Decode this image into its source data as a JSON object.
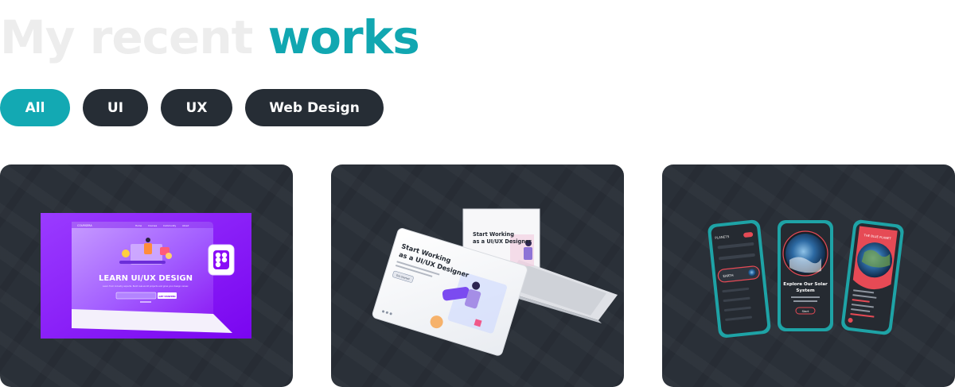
{
  "heading": {
    "muted": "My recent ",
    "accent": "works"
  },
  "filters": [
    {
      "label": "All",
      "active": true
    },
    {
      "label": "UI",
      "active": false
    },
    {
      "label": "UX",
      "active": false
    },
    {
      "label": "Web Design",
      "active": false
    }
  ],
  "projects": [
    {
      "brand": "COURSERA",
      "nav": [
        "Home",
        "Courses",
        "Community",
        "About"
      ],
      "headline": "LEARN UI/UX DESIGN",
      "subtext": "Learn from industry experts. Build real-world projects and grow your design career.",
      "cta": "GET STARTED",
      "icon": "figma-icon"
    },
    {
      "headline_line1": "Start Working",
      "headline_line2": "as a UI/UX Designer",
      "screen_headline_line1": "Start Working",
      "screen_headline_line2": "as a UI/UX Designer",
      "button": "Get Started",
      "device": "laptop-icon"
    },
    {
      "phone1": {
        "title": "PLANETS",
        "selected": "EARTH"
      },
      "phone2": {
        "title_line1": "Explore Our Solar",
        "title_line2": "System",
        "button": "Start"
      },
      "phone3": {
        "title": "THE BLUE PLANET"
      }
    }
  ],
  "colors": {
    "accent": "#11a7b1",
    "pill_dark": "#262d35",
    "card_bg": "#2a3038",
    "purple": "#8a0cf7",
    "phone_frame": "#1ea3a6"
  }
}
